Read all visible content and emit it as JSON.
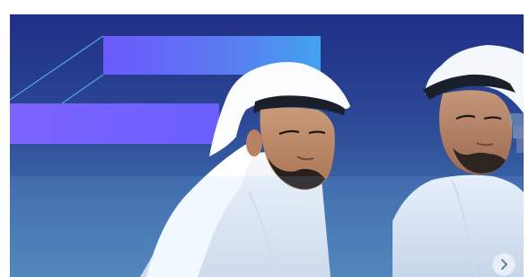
{
  "banner": {
    "theme_colors": {
      "top": "#1f2f86",
      "middle": "#2b4694",
      "bottom": "#4a7fb3",
      "accent_start": "#6d59ff",
      "accent_end": "#43a2ee"
    },
    "controls": {
      "next_icon": "chevron-right-icon"
    }
  }
}
